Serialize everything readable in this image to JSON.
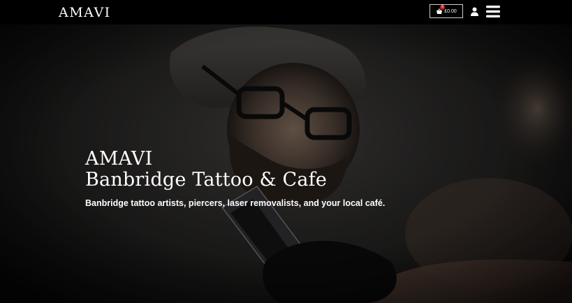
{
  "header": {
    "logo": "AMAVI",
    "cart": {
      "count": "0",
      "total": "£0.00",
      "icon": "basket-icon"
    },
    "account_icon": "user-icon",
    "menu_icon": "hamburger-menu-icon"
  },
  "hero": {
    "title_line1": "AMAVI",
    "title_line2": "Banbridge Tattoo & Cafe",
    "tagline": "Banbridge tattoo artists, piercers, laser removalists, and your local café."
  },
  "colors": {
    "header_bg": "#000000",
    "badge": "#d31b1b",
    "text": "#ffffff"
  }
}
